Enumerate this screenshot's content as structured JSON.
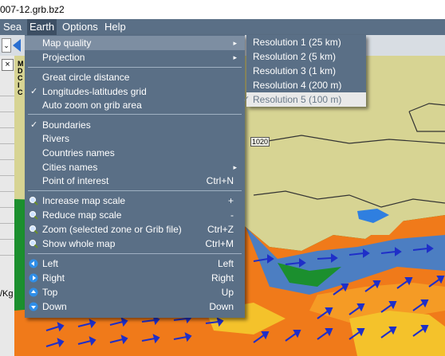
{
  "window": {
    "title": "007-12.grb.bz2"
  },
  "menubar": {
    "items": [
      "Sea",
      "Earth",
      "Options",
      "Help"
    ]
  },
  "left_panel": {
    "close_glyph": "×",
    "partial_label": "/Kg"
  },
  "map": {
    "isobar_label": "1020",
    "vertical_letters": "M D C I C"
  },
  "earth_menu": {
    "map_quality": "Map quality",
    "projection": "Projection",
    "great_circle": "Great circle distance",
    "lon_lat_grid": "Longitudes-latitudes grid",
    "auto_zoom": "Auto zoom on grib area",
    "boundaries": "Boundaries",
    "rivers": "Rivers",
    "countries_names": "Countries names",
    "cities_names": "Cities names",
    "poi": "Point of interest",
    "poi_shortcut": "Ctrl+N",
    "increase_scale": "Increase map scale",
    "increase_shortcut": "+",
    "reduce_scale": "Reduce map scale",
    "reduce_shortcut": "-",
    "zoom": "Zoom (selected zone or Grib file)",
    "zoom_shortcut": "Ctrl+Z",
    "show_whole": "Show whole map",
    "show_whole_shortcut": "Ctrl+M",
    "left": "Left",
    "left_shortcut": "Left",
    "right": "Right",
    "right_shortcut": "Right",
    "top": "Top",
    "top_shortcut": "Up",
    "down": "Down",
    "down_shortcut": "Down",
    "check_glyph": "✓",
    "submenu_arrow": "▸"
  },
  "quality_submenu": {
    "r1": "Resolution 1 (25 km)",
    "r2": "Resolution 2 (5 km)",
    "r3": "Resolution 3 (1 km)",
    "r4": "Resolution 4 (200 m)",
    "r5": "Resolution 5 (100 m)",
    "selected": "Resolution 5 (100 m)"
  },
  "colors": {
    "menu_bg": "#5a6f86",
    "menu_highlight": "#7d8ea2",
    "land": "#d7d493",
    "sea_orange": "#f07a1a",
    "sea_green": "#1b8f2e",
    "sea_blue": "#2f7fe0",
    "arrow_blue": "#1f2fc8"
  }
}
